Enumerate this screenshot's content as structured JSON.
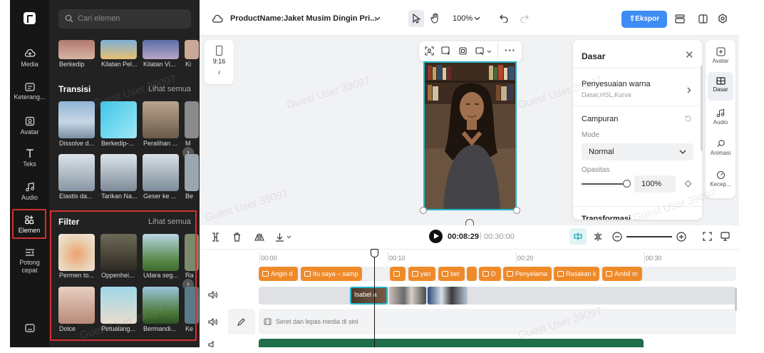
{
  "rail": {
    "items": [
      {
        "label": "Media",
        "icon": "cloud-upload-icon"
      },
      {
        "label": "Keterang...",
        "icon": "captions-icon"
      },
      {
        "label": "Avatar",
        "icon": "avatar-icon"
      },
      {
        "label": "Teks",
        "icon": "text-icon"
      },
      {
        "label": "Audio",
        "icon": "music-note-icon"
      },
      {
        "label": "Elemen",
        "icon": "elements-icon"
      },
      {
        "label": "Potong cepat",
        "icon": "quick-cut-icon"
      }
    ]
  },
  "panel": {
    "search_placeholder": "Cari elemen",
    "top_row": [
      "Berkedip",
      "Kilatan Pel...",
      "Kilatan Vi...",
      "Ki"
    ],
    "transisi": {
      "title": "Transisi",
      "see_all": "Lihat semua",
      "row1": [
        "Dissolve d...",
        "Berkedip-...",
        "Peralihan ...",
        "M"
      ],
      "row2": [
        "Elastis da...",
        "Tarikan Na...",
        "Geser ke ...",
        "Be"
      ]
    },
    "filter": {
      "title": "Filter",
      "see_all": "Lihat semua",
      "row1": [
        "Permen to...",
        "Oppenhei...",
        "Udara seg...",
        "Ra"
      ],
      "row2": [
        "Dolce",
        "Petualang...",
        "Bermandi...",
        "Ke"
      ]
    }
  },
  "topbar": {
    "project_name": "ProductName:Jaket Musim Dingin Pri...",
    "zoom": "100%",
    "export_label": "Ekspor"
  },
  "canvas": {
    "ratio_label": "9:16"
  },
  "props": {
    "title": "Dasar",
    "color_adjust": {
      "title": "Penyesuaian warna",
      "sub": "Dasar,HSL,Kurva"
    },
    "mix": {
      "title": "Campuran",
      "mode_label": "Mode",
      "mode_value": "Normal",
      "opacity_label": "Opasitas",
      "opacity_value": "100%"
    },
    "transform_label": "Transformasi"
  },
  "side_tabs": [
    "Avatar",
    "Dasar",
    "Audio",
    "Animasi",
    "Kecep..."
  ],
  "timeline": {
    "current_time": "00:08:29",
    "total_time": "00:30:00",
    "ticks": [
      "00:00",
      "00:10",
      "00:20",
      "00:30"
    ],
    "caption_clips": [
      "Angin d",
      "Itu saya – samp",
      "",
      "yan",
      "ber",
      "",
      "D",
      "Penyelama",
      "Rasakan k",
      "Ambil m"
    ],
    "video_clip_label": "Isabel a",
    "drop_hint": "Seret dan lepas media di sini"
  },
  "watermark": "Guest User 39097",
  "colors": {
    "accent": "#3d8df5",
    "caption_clip": "#ef8a2a",
    "selection": "#23b6c8",
    "highlight_box": "#d32f2f"
  }
}
